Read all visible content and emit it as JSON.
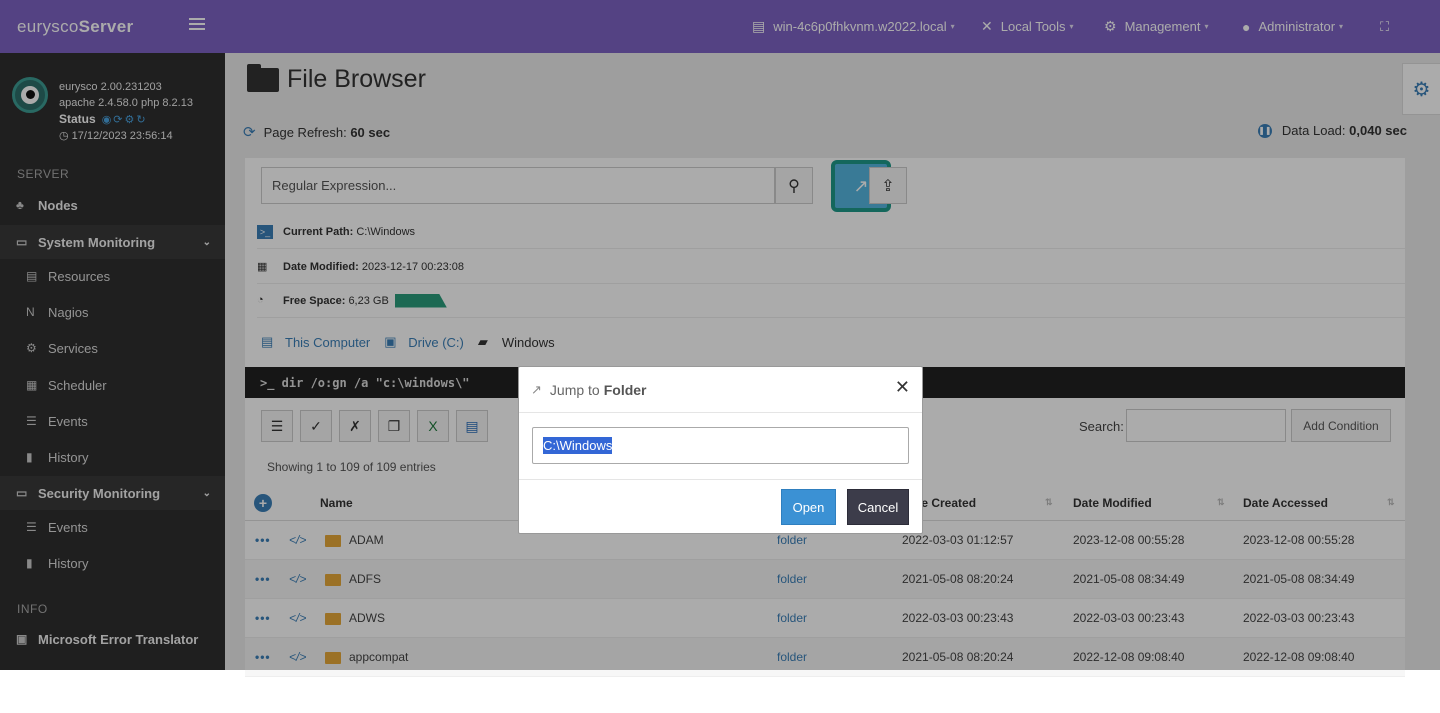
{
  "topbar": {
    "brand_light": "eurysco",
    "brand_bold": "Server",
    "host": "win-4c6p0fhkvnm.w2022.local",
    "local_tools": "Local Tools",
    "management": "Management",
    "user": "Administrator"
  },
  "profile": {
    "line1": "eurysco 2.00.231203",
    "line2": "apache 2.4.58.0  php 8.2.13",
    "status_label": "Status",
    "timestamp": "17/12/2023 23:56:14"
  },
  "sidebar": {
    "server_header": "SERVER",
    "nodes": "Nodes",
    "system_monitoring": "System Monitoring",
    "sys_items": [
      "Resources",
      "Nagios",
      "Services",
      "Scheduler",
      "Events",
      "History"
    ],
    "security_monitoring": "Security Monitoring",
    "sec_items": [
      "Events",
      "History"
    ],
    "info_header": "INFO",
    "error_translator": "Microsoft Error Translator"
  },
  "page": {
    "title": "File Browser",
    "refresh_label": "Page Refresh:",
    "refresh_value": "60 sec",
    "dataload_label": "Data Load:",
    "dataload_value": "0,040 sec",
    "regex_placeholder": "Regular Expression...",
    "current_path_label": "Current Path:",
    "current_path": "C:\\Windows",
    "date_modified_label": "Date Modified:",
    "date_modified": "2023-12-17 00:23:08",
    "free_space_label": "Free Space:",
    "free_space": "6,23 GB",
    "breadcrumb": [
      "This Computer",
      "Drive (C:)",
      "Windows"
    ],
    "command": ">_  dir /o:gn /a \"c:\\windows\\\"",
    "search_label": "Search:",
    "add_condition": "Add Condition",
    "showing": "Showing 1 to 109 of 109 entries"
  },
  "table": {
    "headers": [
      "Name",
      "Date Created",
      "Date Modified",
      "Date Accessed"
    ],
    "rows": [
      {
        "name": "ADAM",
        "type": "folder",
        "created": "2022-03-03 01:12:57",
        "modified": "2023-12-08 00:55:28",
        "accessed": "2023-12-08 00:55:28"
      },
      {
        "name": "ADFS",
        "type": "folder",
        "created": "2021-05-08 08:20:24",
        "modified": "2021-05-08 08:34:49",
        "accessed": "2021-05-08 08:34:49"
      },
      {
        "name": "ADWS",
        "type": "folder",
        "created": "2022-03-03 00:23:43",
        "modified": "2022-03-03 00:23:43",
        "accessed": "2022-03-03 00:23:43"
      },
      {
        "name": "appcompat",
        "type": "folder",
        "created": "2021-05-08 08:20:24",
        "modified": "2022-12-08 09:08:40",
        "accessed": "2022-12-08 09:08:40"
      }
    ]
  },
  "modal": {
    "title_light": "Jump to",
    "title_bold": "Folder",
    "input_value": "C:\\Windows",
    "open": "Open",
    "cancel": "Cancel"
  }
}
